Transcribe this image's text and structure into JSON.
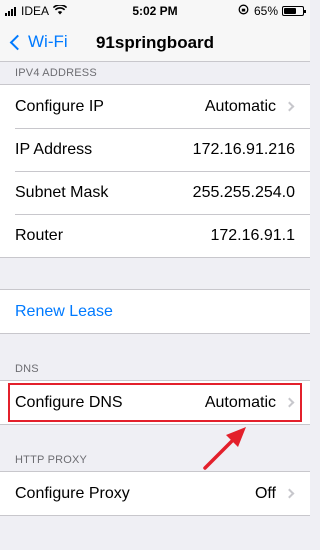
{
  "status_bar": {
    "carrier": "IDEA",
    "time": "5:02 PM",
    "battery": "65%",
    "battery_level": 0.65
  },
  "nav": {
    "back_label": "Wi-Fi",
    "title": "91springboard"
  },
  "ipv4": {
    "header": "IPV4 ADDRESS",
    "rows": [
      {
        "label": "Configure IP",
        "value": "Automatic"
      },
      {
        "label": "IP Address",
        "value": "172.16.91.216"
      },
      {
        "label": "Subnet Mask",
        "value": "255.255.254.0"
      },
      {
        "label": "Router",
        "value": "172.16.91.1"
      }
    ]
  },
  "lease": {
    "renew_label": "Renew Lease"
  },
  "dns": {
    "header": "DNS",
    "configure_label": "Configure DNS",
    "configure_value": "Automatic"
  },
  "proxy": {
    "header": "HTTP PROXY",
    "configure_label": "Configure Proxy",
    "configure_value": "Off"
  },
  "colors": {
    "accent": "#007aff",
    "annotation": "#e3202b",
    "background": "#efeff4"
  }
}
